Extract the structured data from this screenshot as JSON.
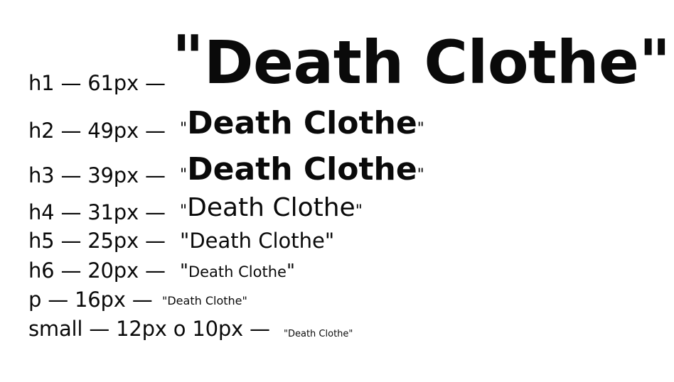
{
  "rows": [
    {
      "label": "h1 — 61px —",
      "open": "\"",
      "sample": "Death Clothe",
      "close": "\""
    },
    {
      "label": "h2 — 49px —",
      "open": "\"",
      "sample": "Death Clothe",
      "close": "\""
    },
    {
      "label": "h3 — 39px —",
      "open": "\"",
      "sample": "Death Clothe",
      "close": "\""
    },
    {
      "label": "h4 — 31px —",
      "open": "\"",
      "sample": "Death Clothe",
      "close": "\""
    },
    {
      "label": "h5 — 25px —",
      "open": "\"",
      "sample": "Death Clothe",
      "close": "\""
    },
    {
      "label": "h6 — 20px —",
      "open": "\"",
      "sample": "Death Clothe",
      "close": "\""
    },
    {
      "label": "p — 16px —",
      "open": "\"",
      "sample": "Death Clothe",
      "close": "\""
    },
    {
      "label": "small — 12px o 10px —",
      "open": "\"",
      "sample": "Death Clothe",
      "close": "\""
    }
  ]
}
